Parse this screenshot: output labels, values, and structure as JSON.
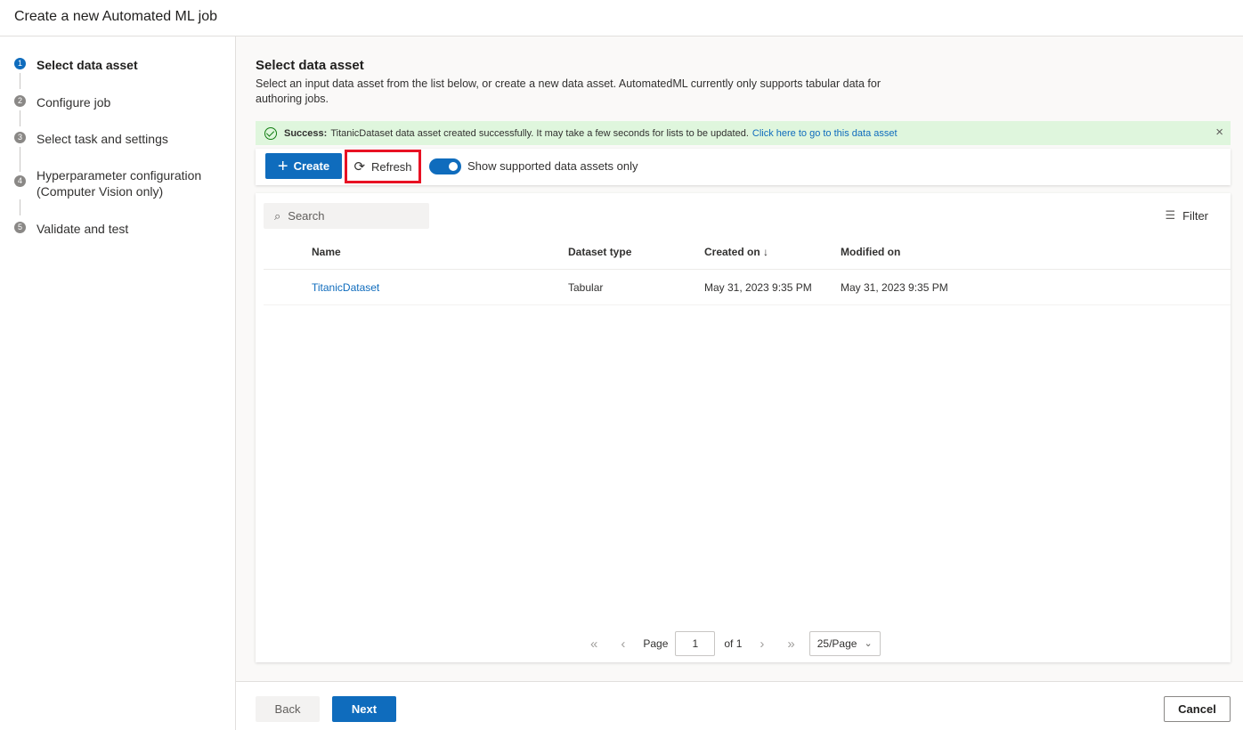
{
  "header": {
    "title": "Create a new Automated ML job"
  },
  "steps": [
    {
      "num": "1",
      "label": "Select data asset"
    },
    {
      "num": "2",
      "label": "Configure job"
    },
    {
      "num": "3",
      "label": "Select task and settings"
    },
    {
      "num": "4",
      "label": "Hyperparameter configuration (Computer Vision only)"
    },
    {
      "num": "5",
      "label": "Validate and test"
    }
  ],
  "main": {
    "title": "Select data asset",
    "description": "Select an input data asset from the list below, or create a new data asset. AutomatedML currently only supports tabular data for authoring jobs."
  },
  "banner": {
    "icon": "check-circle-icon",
    "bold": "Success:",
    "message": "TitanicDataset data asset created successfully. It may take a few seconds for lists to be updated.",
    "link": "Click here to go to this data asset",
    "close_icon": "×",
    "color": "#dff6dd"
  },
  "toolbar": {
    "create_icon": "+",
    "create_label": "Create",
    "refresh_icon": "⟳",
    "refresh_label": "Refresh",
    "toggle_label": "Show supported data assets only",
    "accent_color": "#0f6cbd",
    "highlight_color": "#e81123"
  },
  "table": {
    "search_icon": "⌕",
    "search_placeholder": "Search",
    "filter_icon": "☰",
    "filter_label": "Filter",
    "columns": [
      {
        "label": "Name"
      },
      {
        "label": "Dataset type"
      },
      {
        "label": "Created on ↓"
      },
      {
        "label": "Modified on"
      }
    ],
    "rows": [
      {
        "name": "TitanicDataset",
        "type": "Tabular",
        "created": "May 31, 2023 9:35 PM",
        "modified": "May 31, 2023 9:35 PM"
      }
    ]
  },
  "pager": {
    "first": "«",
    "prev": "‹",
    "page_label": "Page",
    "page_value": "1",
    "of_label": "of 1",
    "next": "›",
    "last": "»",
    "page_size": "25/Page",
    "chevron": "⌄"
  },
  "footer": {
    "back": "Back",
    "next": "Next",
    "cancel": "Cancel"
  }
}
